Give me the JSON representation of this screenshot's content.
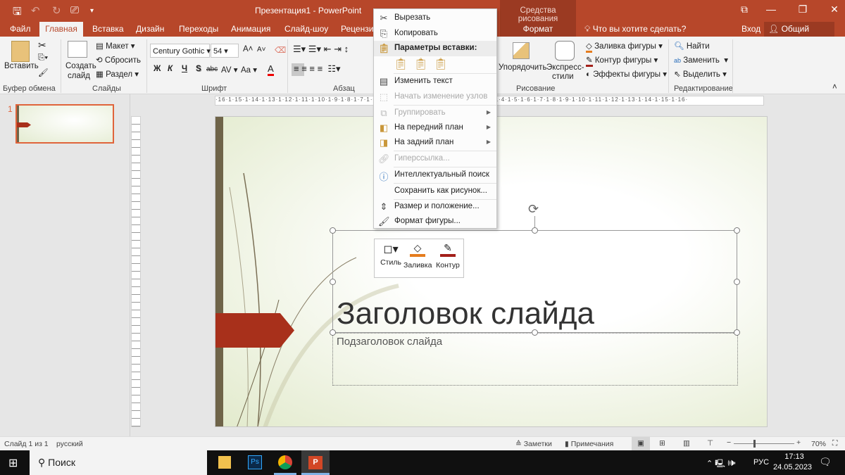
{
  "app": {
    "title": "Презентация1 - PowerPoint",
    "context_tab_group": "Средства рисования",
    "context_tab": "Формат",
    "tell_me": "Что вы хотите сделать?",
    "signin": "Вход",
    "share": "Общий доступ"
  },
  "tabs": [
    "Файл",
    "Главная",
    "Вставка",
    "Дизайн",
    "Переходы",
    "Анимация",
    "Слайд-шоу",
    "Рецензирование"
  ],
  "ribbon": {
    "clipboard": {
      "paste": "Вставить",
      "group": "Буфер обмена"
    },
    "slides": {
      "new_slide_1": "Создать",
      "new_slide_2": "слайд",
      "layout": "Макет",
      "reset": "Сбросить",
      "section": "Раздел",
      "group": "Слайды"
    },
    "font": {
      "font_name": "Century Gothic",
      "font_size": "54",
      "bold": "Ж",
      "italic": "К",
      "underline": "Ч",
      "shadow": "S",
      "strike": "abc",
      "spacing": "AV",
      "case": "Aa",
      "color_a": "A",
      "group": "Шрифт"
    },
    "paragraph": {
      "group": "Абзац"
    },
    "drawing": {
      "arrange": "Упорядочить",
      "quick_styles_1": "Экспресс-",
      "quick_styles_2": "стили",
      "fill": "Заливка фигуры",
      "outline": "Контур фигуры",
      "effects": "Эффекты фигуры",
      "group": "Рисование"
    },
    "editing": {
      "find": "Найти",
      "replace": "Заменить",
      "select": "Выделить",
      "group": "Редактирование"
    }
  },
  "ruler_h": "·16·1·15·1·14·1·13·1·12·1·11·1·10·1·9·1·8·1·7·1·6·1·5·1·4·1·3·1·2·1·1·1·0·1·1·1·2·1·3·1·4·1·5·1·6·1·7·1·8·1·9·1·10·1·11·1·12·1·13·1·14·1·15·1·16·",
  "thumb": {
    "number": "1"
  },
  "slide": {
    "title": "Заголовок слайда",
    "subtitle": "Подзаголовок слайда",
    "accent": "#a8301b",
    "band": "#6f6449"
  },
  "context_menu": {
    "cut": "Вырезать",
    "copy": "Копировать",
    "paste_options": "Параметры вставки:",
    "edit_text": "Изменить текст",
    "edit_points": "Начать изменение узлов",
    "group": "Группировать",
    "bring_front": "На передний план",
    "send_back": "На задний план",
    "hyperlink": "Гиперссылка...",
    "smart_lookup": "Интеллектуальный поиск",
    "save_picture": "Сохранить как рисунок...",
    "size_position": "Размер и положение...",
    "format_shape": "Формат фигуры..."
  },
  "mini_toolbar": {
    "style": "Стиль",
    "fill": "Заливка",
    "outline": "Контур"
  },
  "status": {
    "slide": "Слайд 1 из 1",
    "language": "русский",
    "notes": "Заметки",
    "comments": "Примечания",
    "zoom": "70%",
    "zoom_percent": 70
  },
  "taskbar": {
    "search": "Поиск",
    "lang": "РУС",
    "time": "17:13",
    "date": "24.05.2023"
  },
  "colors": {
    "brand": "#b7472a",
    "selection": "#e0643b"
  }
}
